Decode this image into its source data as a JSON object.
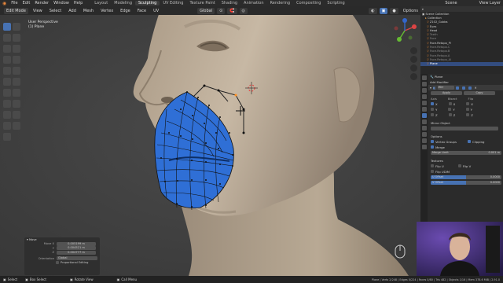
{
  "menu": [
    "File",
    "Edit",
    "Render",
    "Window",
    "Help"
  ],
  "workspaces": [
    "Layout",
    "Modeling",
    "Sculpting",
    "UV Editing",
    "Texture Paint",
    "Shading",
    "Animation",
    "Rendering",
    "Compositing",
    "Scripting"
  ],
  "active_workspace": "Sculpting",
  "scene_label": "Scene",
  "view_layer_label": "View Layer",
  "header": {
    "mode": "Edit Mode",
    "view": "View",
    "select": "Select",
    "add": "Add",
    "mesh": "Mesh",
    "vertex": "Vertex",
    "edge": "Edge",
    "face": "Face",
    "uv": "UV",
    "transform": "Global",
    "options": "Options"
  },
  "viewport": {
    "view_name": "User Perspective",
    "object_name": "(1) Plane"
  },
  "outliner": {
    "title": "Scene Collection",
    "items": [
      "Collection",
      "Z102_Gubbs",
      "Eyes",
      "Head",
      "Teeth",
      "Face",
      "Face.Retopo_Pl",
      "Face.Retopo.C",
      "Face.Retopo.B",
      "Face.Retopo.A",
      "Face.Retopo_Al",
      "Plane"
    ]
  },
  "properties": {
    "object": "Plane",
    "add_modifier": "Add Modifier",
    "modifier_name": "Mirr",
    "apply": "Apply",
    "copy": "Copy",
    "axis": "Axis",
    "bisect": "Bisect",
    "flip": "Flip",
    "x": "X",
    "y": "Y",
    "z": "Z",
    "mirror_object": "Mirror Object",
    "options": "Options",
    "vertex_groups": "Vertex Groups",
    "clipping": "Clipping",
    "merge": "Merge",
    "merge_limit": "Merge Limit",
    "merge_limit_value": "0.001 m",
    "textures": "Textures",
    "flip_u": "Flip U",
    "flip_v": "Flip V",
    "flip_udim": "Flip UDIM",
    "u_offset": "U Offset",
    "v_offset": "V Offset",
    "u_offset_value": "0.0000",
    "v_offset_value": "0.0000"
  },
  "operator": {
    "title": "Move",
    "move_x_label": "Move X",
    "move_x": "0.005199 m",
    "y_label": "Y",
    "y": "0.004521 m",
    "z_label": "Z",
    "z": "0.004777 m",
    "orientation_label": "Orientation",
    "orientation": "Global",
    "proportional": "Proportional Editing"
  },
  "status": {
    "select": "Select",
    "box_select": "Box Select",
    "rotate": "Rotate View",
    "call_menu": "Call Menu",
    "stats": "Plane | Verts 2/248 | Edges 0/224 | Faces 0/80 | Tris 482 | Objects 1/16 | Mem 378.6 MiB | 2.91.0"
  },
  "colors": {
    "accent": "#4772b3",
    "mesh": "#2e6fd6",
    "skin": "#b9aa98",
    "bg": "#3f3f3f"
  }
}
